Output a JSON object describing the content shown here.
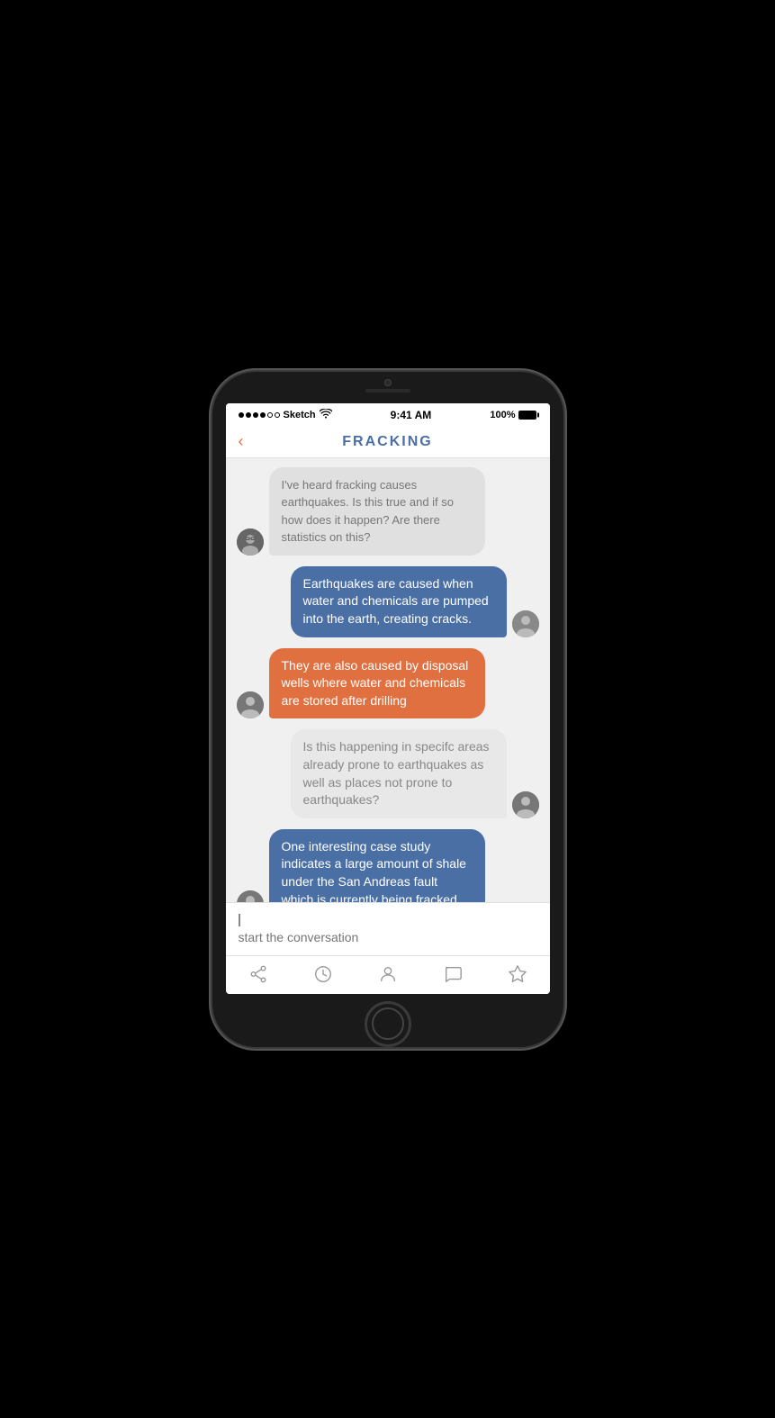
{
  "phone": {
    "status_bar": {
      "carrier": "Sketch",
      "wifi": "wifi",
      "time": "9:41 AM",
      "battery_percent": "100%",
      "dots": [
        "filled",
        "filled",
        "filled",
        "filled",
        "empty",
        "empty"
      ]
    },
    "nav": {
      "back_label": "‹",
      "title": "FRACKING"
    },
    "messages": [
      {
        "id": "msg1",
        "side": "left",
        "avatar": "avatar-1",
        "text": "I've heard fracking causes earthquakes. Is this true and if so how does it happen? Are there statistics on this?",
        "bubble_style": "gray",
        "truncated": true
      },
      {
        "id": "msg2",
        "side": "right",
        "avatar": "avatar-2",
        "text": "Earthquakes are caused when water and chemicals are pumped into the earth, creating cracks.",
        "bubble_style": "blue"
      },
      {
        "id": "msg3",
        "side": "left",
        "avatar": "avatar-2",
        "text": "They are also caused by disposal wells where water and chemicals are stored after drilling",
        "bubble_style": "orange"
      },
      {
        "id": "msg4",
        "side": "right",
        "avatar": "avatar-3",
        "text": "Is this happening in specifc areas already prone to earthquakes as well as places not prone to earthquakes?",
        "bubble_style": "lightgray"
      },
      {
        "id": "msg5",
        "side": "left",
        "avatar": "avatar-2",
        "text": "One interesting case study indicates a large amount of shale under the San Andreas fault which is currently being fracked.",
        "bubble_style": "blue"
      }
    ],
    "input": {
      "placeholder": "start the conversation"
    },
    "tabs": [
      {
        "id": "share",
        "icon": "share"
      },
      {
        "id": "history",
        "icon": "clock"
      },
      {
        "id": "profile",
        "icon": "person"
      },
      {
        "id": "chat",
        "icon": "chat"
      },
      {
        "id": "star",
        "icon": "star"
      }
    ]
  }
}
